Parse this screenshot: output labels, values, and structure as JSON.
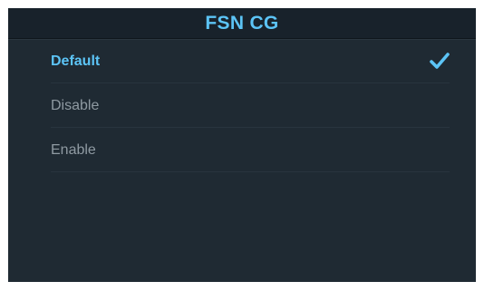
{
  "title": "FSN CG",
  "options": [
    {
      "label": "Default",
      "selected": true
    },
    {
      "label": "Disable",
      "selected": false
    },
    {
      "label": "Enable",
      "selected": false
    }
  ],
  "selected_icon": "checkmark-icon",
  "colors": {
    "accent": "#5cc4f6",
    "panel_background": "#1f2a33",
    "titlebar_background": "#18222b",
    "unselected_text": "#8f9aa2",
    "divider": "#28343e"
  }
}
